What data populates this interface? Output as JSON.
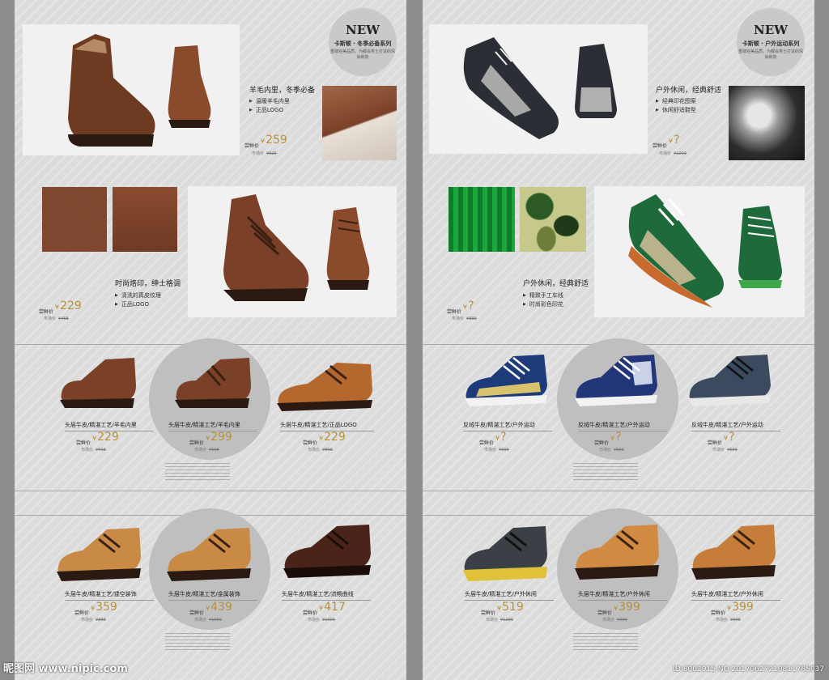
{
  "left": {
    "badge": {
      "new": "NEW",
      "series": "卡斯顿 · 冬季必备系列",
      "desc": "重磅完美品质，为都会男士打造的风尚新款"
    },
    "hero1": {
      "title": "羊毛内里，冬季必备",
      "items": [
        "温暖羊毛内里",
        "正品LOGO"
      ],
      "price_label": "尝鲜价",
      "price": "259",
      "old_label": "市场价",
      "old_price": "¥526"
    },
    "hero2": {
      "title": "时尚烙印，绅士格调",
      "items": [
        "清洗的真皮纹理",
        "正品LOGO"
      ],
      "price_label": "尝鲜价",
      "price": "229",
      "old_label": "市场价",
      "old_price": "¥458"
    },
    "row1": [
      {
        "name": "头层牛皮/精湛工艺/羊毛内里",
        "price_label": "尝鲜价",
        "price": "229",
        "old_label": "市场价",
        "old_price": "¥598"
      },
      {
        "name": "头层牛皮/精湛工艺/羊毛内里",
        "price_label": "尝鲜价",
        "price": "299",
        "old_label": "市场价",
        "old_price": "¥598"
      },
      {
        "name": "头层牛皮/精湛工艺/正品LOGO",
        "price_label": "尝鲜价",
        "price": "229",
        "old_label": "市场价",
        "old_price": "¥899"
      }
    ],
    "row2": [
      {
        "name": "头层牛皮/精湛工艺/镂空装饰",
        "price_label": "尝鲜价",
        "price": "359",
        "old_label": "市场价",
        "old_price": "¥899"
      },
      {
        "name": "头层牛皮/精湛工艺/金属装饰",
        "price_label": "尝鲜价",
        "price": "439",
        "old_label": "市场价",
        "old_price": "¥1099"
      },
      {
        "name": "头层牛皮/精湛工艺/流畅曲线",
        "price_label": "尝鲜价",
        "price": "417",
        "old_label": "市场价",
        "old_price": "¥1099"
      }
    ]
  },
  "right": {
    "badge": {
      "new": "NEW",
      "series": "卡斯顿 · 户外运动系列",
      "desc": "重磅完美品质，为都会男士打造的风尚新款"
    },
    "hero1": {
      "title": "户外休闲，经典舒适",
      "items": [
        "经典印花图案",
        "休闲舒适鞋型"
      ],
      "price_label": "尝鲜价",
      "price": "?",
      "old_label": "市场价",
      "old_price": "¥1099"
    },
    "hero2": {
      "title": "户外休闲，经典舒适",
      "items": [
        "精致手工车线",
        "时尚彩色印花"
      ],
      "price_label": "尝鲜价",
      "price": "?",
      "old_label": "市场价",
      "old_price": "¥899"
    },
    "row1": [
      {
        "name": "反绒牛皮/精湛工艺/户外运动",
        "price_label": "尝鲜价",
        "price": "?",
        "old_label": "市场价",
        "old_price": "¥599"
      },
      {
        "name": "反绒牛皮/精湛工艺/户外运动",
        "price_label": "尝鲜价",
        "price": "?",
        "old_label": "市场价",
        "old_price": "¥559"
      },
      {
        "name": "反绒牛皮/精湛工艺/户外运动",
        "price_label": "尝鲜价",
        "price": "?",
        "old_label": "市场价",
        "old_price": "¥599"
      }
    ],
    "row2": [
      {
        "name": "头层牛皮/精湛工艺/户外休闲",
        "price_label": "尝鲜价",
        "price": "519",
        "old_label": "市场价",
        "old_price": "¥1299"
      },
      {
        "name": "头层牛皮/精湛工艺/户外休闲",
        "price_label": "尝鲜价",
        "price": "399",
        "old_label": "市场价",
        "old_price": "¥999"
      },
      {
        "name": "头层牛皮/精湛工艺/户外休闲",
        "price_label": "尝鲜价",
        "price": "399",
        "old_label": "市场价",
        "old_price": "¥999"
      }
    ]
  },
  "watermark": {
    "site": "昵图网 www.nipic.com",
    "id": "ID:8002915 NO:20170627210811785037"
  },
  "colors": {
    "price": "#b8913a",
    "leather_brown": "#7a4128",
    "tan": "#c98a45",
    "sneaker_dark": "#2b2e34",
    "camo_green": "#1f6a3a"
  }
}
